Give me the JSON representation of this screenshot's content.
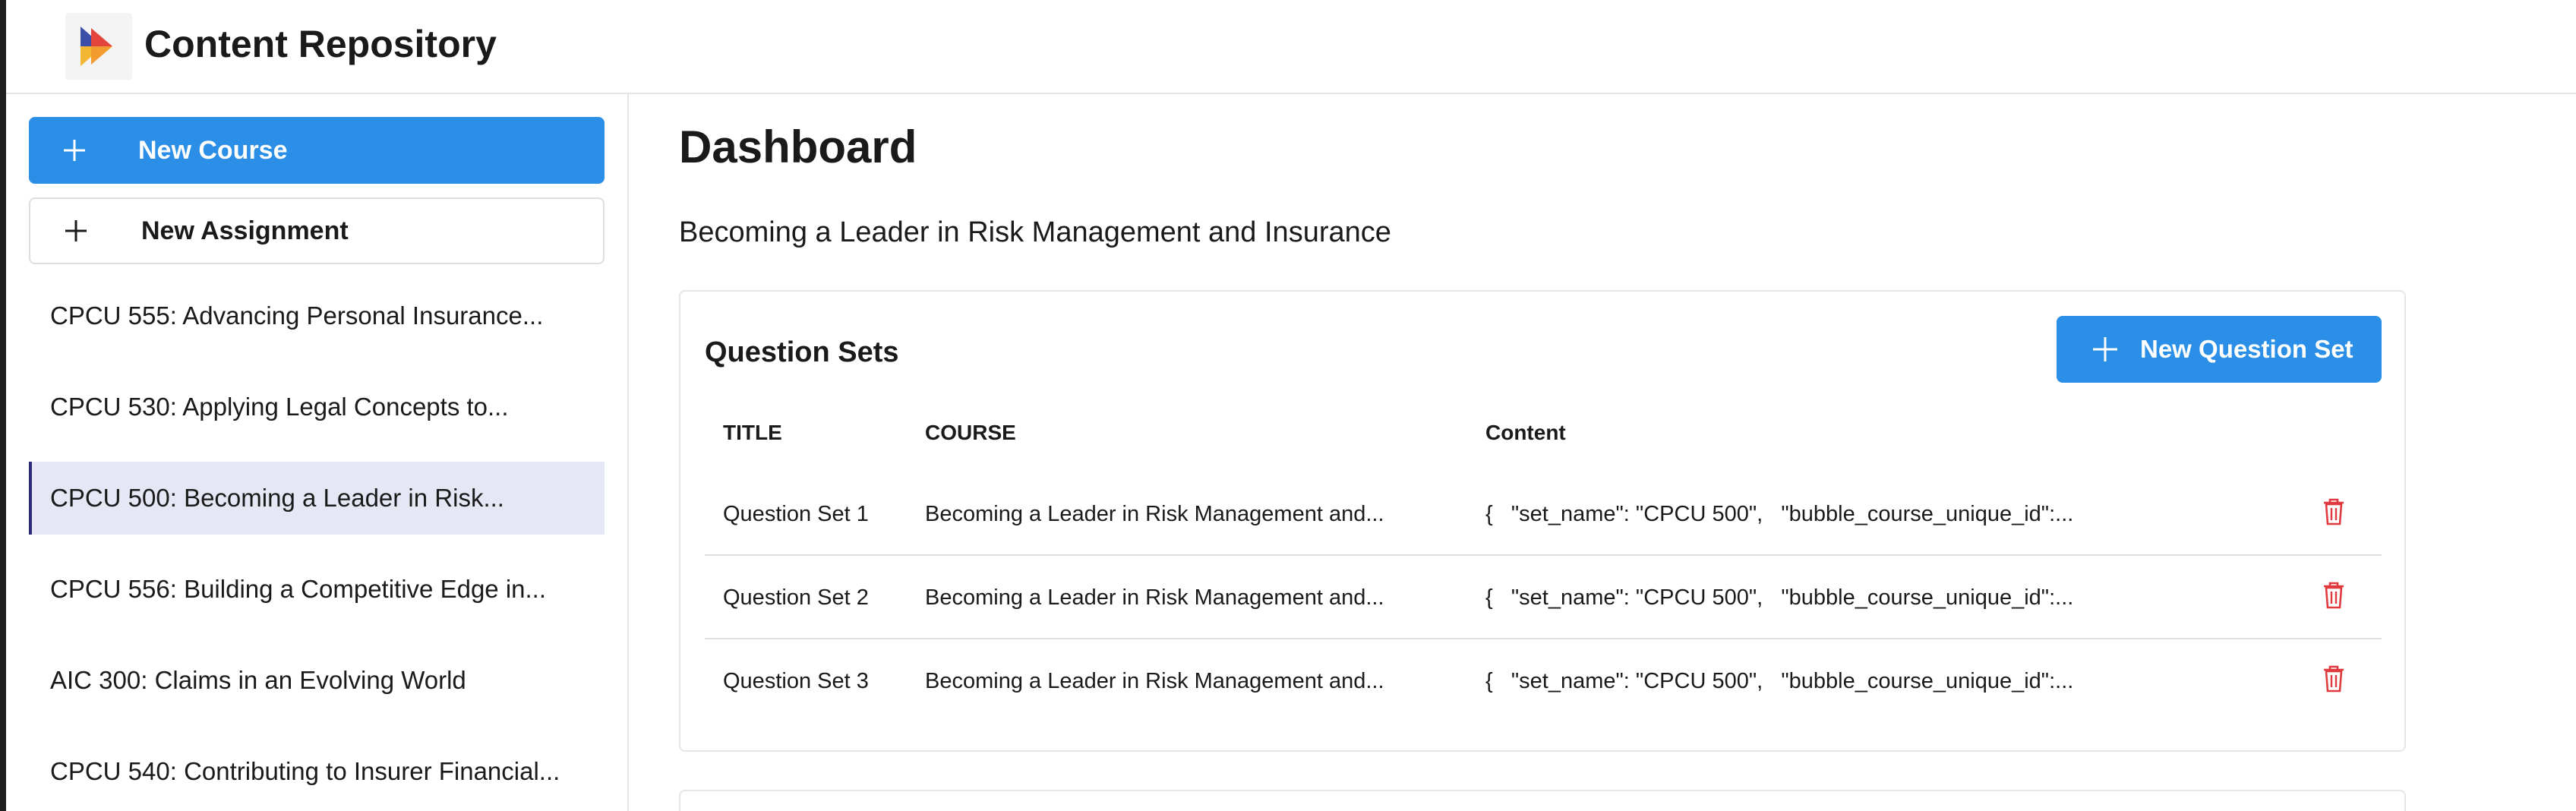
{
  "header": {
    "title": "Content Repository",
    "logo_icon": "play-logo-icon"
  },
  "sidebar": {
    "new_course_label": "New Course",
    "new_assignment_label": "New Assignment",
    "courses": [
      {
        "label": "CPCU 555: Advancing Personal Insurance...",
        "active": false
      },
      {
        "label": "CPCU 530: Applying Legal Concepts to...",
        "active": false
      },
      {
        "label": "CPCU 500: Becoming a Leader in Risk...",
        "active": true
      },
      {
        "label": "CPCU 556: Building a Competitive Edge in...",
        "active": false
      },
      {
        "label": "AIC 300: Claims in an Evolving World",
        "active": false
      },
      {
        "label": "CPCU 540: Contributing to Insurer Financial...",
        "active": false
      }
    ]
  },
  "main": {
    "title": "Dashboard",
    "course_subtitle": "Becoming a Leader in Risk Management and Insurance",
    "question_sets": {
      "title": "Question Sets",
      "new_button_label": "New Question Set",
      "columns": [
        "TITLE",
        "COURSE",
        "Content"
      ],
      "rows": [
        {
          "title": "Question Set 1",
          "course": "Becoming a Leader in Risk Management and...",
          "content": "{   \"set_name\": \"CPCU 500\",   \"bubble_course_unique_id\":..."
        },
        {
          "title": "Question Set 2",
          "course": "Becoming a Leader in Risk Management and...",
          "content": "{   \"set_name\": \"CPCU 500\",   \"bubble_course_unique_id\":..."
        },
        {
          "title": "Question Set 3",
          "course": "Becoming a Leader in Risk Management and...",
          "content": "{   \"set_name\": \"CPCU 500\",   \"bubble_course_unique_id\":..."
        }
      ]
    }
  },
  "colors": {
    "primary": "#2b8fe8",
    "active_bg": "#e6e7f5",
    "active_border": "#2e2a7a",
    "danger": "#e0393e"
  }
}
